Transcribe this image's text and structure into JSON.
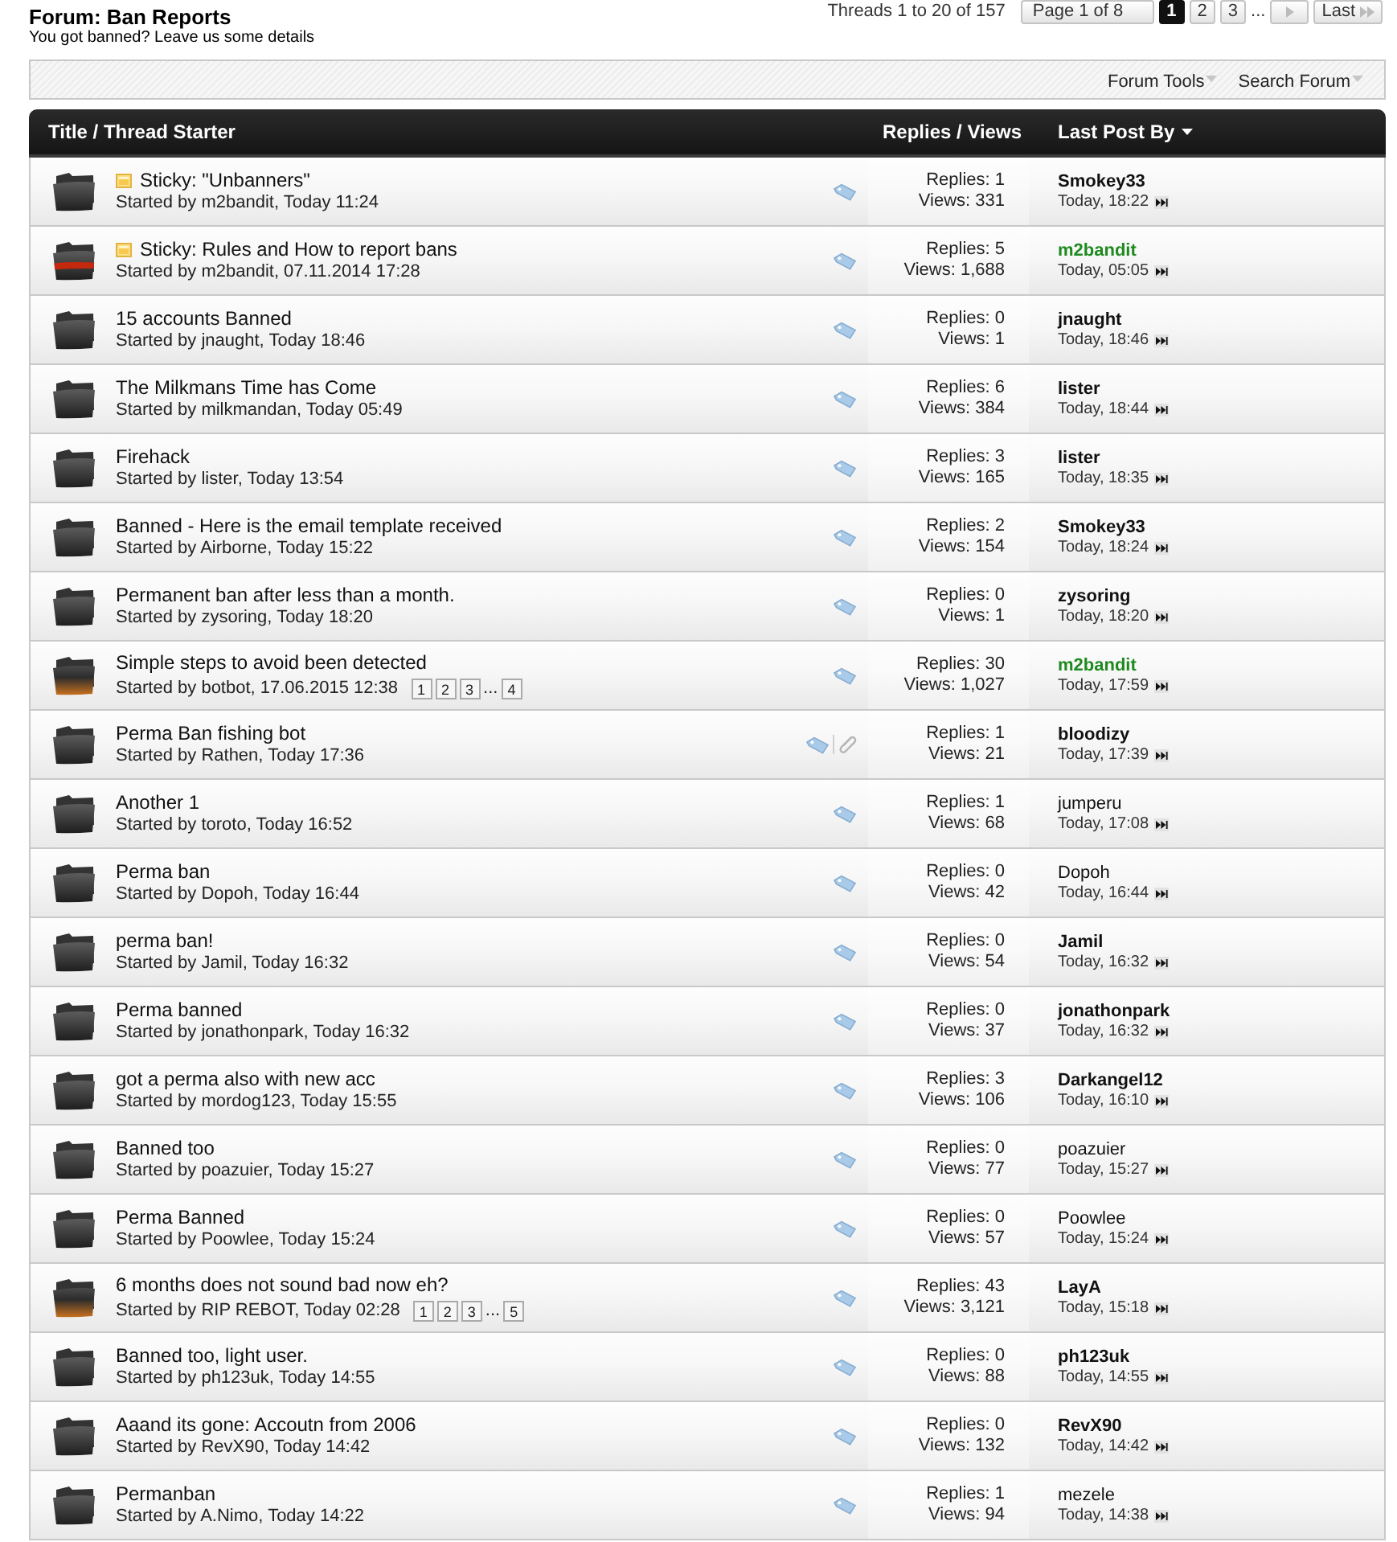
{
  "forum": {
    "title": "Forum: Ban Reports",
    "description": "You got banned? Leave us some details"
  },
  "pagination": {
    "summary": "Threads 1 to 20 of 157",
    "page_label": "Page 1 of 8",
    "pages": [
      {
        "label": "1",
        "selected": true
      },
      {
        "label": "2",
        "selected": false
      },
      {
        "label": "3",
        "selected": false
      }
    ],
    "gap": "...",
    "last": "Last"
  },
  "toolbar": [
    {
      "label": "Forum Tools"
    },
    {
      "label": "Search Forum"
    }
  ],
  "columns": [
    {
      "label": "Title / Thread Starter",
      "sorted": false
    },
    {
      "label": "Replies / Views",
      "sorted": false
    },
    {
      "label": "Last Post By",
      "sorted": true
    }
  ],
  "threads": [
    {
      "hot": false,
      "banded": false,
      "sticky": true,
      "title": "Sticky: \"Unbanners\"",
      "starter": "Started by m2bandit, Today 11:24",
      "tagged": true,
      "attachment": false,
      "replies": "Replies: 1",
      "views": "Views: 331",
      "last_post": {
        "user": "Smokey33",
        "bold": true,
        "color": "#111111",
        "time": "Today, 18:22"
      }
    },
    {
      "hot": false,
      "banded": true,
      "sticky": true,
      "title": "Sticky: Rules and How to report bans",
      "starter": "Started by m2bandit, 07.11.2014 17:28",
      "tagged": true,
      "attachment": false,
      "replies": "Replies: 5",
      "views": "Views: 1,688",
      "last_post": {
        "user": "m2bandit",
        "bold": true,
        "color": "#1f8a1f",
        "time": "Today, 05:05"
      }
    },
    {
      "hot": false,
      "banded": false,
      "sticky": false,
      "title": "15 accounts Banned",
      "starter": "Started by jnaught, Today 18:46",
      "tagged": true,
      "attachment": false,
      "replies": "Replies: 0",
      "views": "Views: 1",
      "last_post": {
        "user": "jnaught",
        "bold": true,
        "color": "#111111",
        "time": "Today, 18:46"
      }
    },
    {
      "hot": false,
      "banded": false,
      "sticky": false,
      "title": "The Milkmans Time has Come",
      "starter": "Started by milkmandan, Today 05:49",
      "tagged": true,
      "attachment": false,
      "replies": "Replies: 6",
      "views": "Views: 384",
      "last_post": {
        "user": "lister",
        "bold": true,
        "color": "#111111",
        "time": "Today, 18:44"
      }
    },
    {
      "hot": false,
      "banded": false,
      "sticky": false,
      "title": "Firehack",
      "starter": "Started by lister, Today 13:54",
      "tagged": true,
      "attachment": false,
      "replies": "Replies: 3",
      "views": "Views: 165",
      "last_post": {
        "user": "lister",
        "bold": true,
        "color": "#111111",
        "time": "Today, 18:35"
      }
    },
    {
      "hot": false,
      "banded": false,
      "sticky": false,
      "title": "Banned - Here is the email template received",
      "starter": "Started by Airborne, Today 15:22",
      "tagged": true,
      "attachment": false,
      "replies": "Replies: 2",
      "views": "Views: 154",
      "last_post": {
        "user": "Smokey33",
        "bold": true,
        "color": "#111111",
        "time": "Today, 18:24"
      }
    },
    {
      "hot": false,
      "banded": false,
      "sticky": false,
      "title": "Permanent ban after less than a month.",
      "starter": "Started by zysoring, Today 18:20",
      "tagged": true,
      "attachment": false,
      "replies": "Replies: 0",
      "views": "Views: 1",
      "last_post": {
        "user": "zysoring",
        "bold": true,
        "color": "#111111",
        "time": "Today, 18:20"
      }
    },
    {
      "hot": true,
      "banded": false,
      "sticky": false,
      "title": "Simple steps to avoid been detected",
      "starter": "Started by botbot, 17.06.2015 12:38",
      "pages": [
        "1",
        "2",
        "3"
      ],
      "gap": "...",
      "last_page": "4",
      "tagged": true,
      "attachment": false,
      "replies": "Replies: 30",
      "views": "Views: 1,027",
      "last_post": {
        "user": "m2bandit",
        "bold": true,
        "color": "#1f8a1f",
        "time": "Today, 17:59"
      }
    },
    {
      "hot": false,
      "banded": false,
      "sticky": false,
      "title": "Perma Ban fishing bot",
      "starter": "Started by Rathen, Today 17:36",
      "tagged": true,
      "attachment": true,
      "replies": "Replies: 1",
      "views": "Views: 21",
      "last_post": {
        "user": "bloodizy",
        "bold": true,
        "color": "#111111",
        "time": "Today, 17:39"
      }
    },
    {
      "hot": false,
      "banded": false,
      "sticky": false,
      "title": "Another 1",
      "starter": "Started by toroto, Today 16:52",
      "tagged": true,
      "attachment": false,
      "replies": "Replies: 1",
      "views": "Views: 68",
      "last_post": {
        "user": "jumperu",
        "bold": false,
        "color": "#111111",
        "time": "Today, 17:08"
      }
    },
    {
      "hot": false,
      "banded": false,
      "sticky": false,
      "title": "Perma ban",
      "starter": "Started by Dopoh, Today 16:44",
      "tagged": true,
      "attachment": false,
      "replies": "Replies: 0",
      "views": "Views: 42",
      "last_post": {
        "user": "Dopoh",
        "bold": false,
        "color": "#111111",
        "time": "Today, 16:44"
      }
    },
    {
      "hot": false,
      "banded": false,
      "sticky": false,
      "title": "perma ban!",
      "starter": "Started by Jamil, Today 16:32",
      "tagged": true,
      "attachment": false,
      "replies": "Replies: 0",
      "views": "Views: 54",
      "last_post": {
        "user": "Jamil",
        "bold": true,
        "color": "#111111",
        "time": "Today, 16:32"
      }
    },
    {
      "hot": false,
      "banded": false,
      "sticky": false,
      "title": "Perma banned",
      "starter": "Started by jonathonpark, Today 16:32",
      "tagged": true,
      "attachment": false,
      "replies": "Replies: 0",
      "views": "Views: 37",
      "last_post": {
        "user": "jonathonpark",
        "bold": true,
        "color": "#111111",
        "time": "Today, 16:32"
      }
    },
    {
      "hot": false,
      "banded": false,
      "sticky": false,
      "title": "got a perma also with new acc",
      "starter": "Started by mordog123, Today 15:55",
      "tagged": true,
      "attachment": false,
      "replies": "Replies: 3",
      "views": "Views: 106",
      "last_post": {
        "user": "Darkangel12",
        "bold": true,
        "color": "#111111",
        "time": "Today, 16:10"
      }
    },
    {
      "hot": false,
      "banded": false,
      "sticky": false,
      "title": "Banned too",
      "starter": "Started by poazuier, Today 15:27",
      "tagged": true,
      "attachment": false,
      "replies": "Replies: 0",
      "views": "Views: 77",
      "last_post": {
        "user": "poazuier",
        "bold": false,
        "color": "#111111",
        "time": "Today, 15:27"
      }
    },
    {
      "hot": false,
      "banded": false,
      "sticky": false,
      "title": "Perma Banned",
      "starter": "Started by Poowlee, Today 15:24",
      "tagged": true,
      "attachment": false,
      "replies": "Replies: 0",
      "views": "Views: 57",
      "last_post": {
        "user": "Poowlee",
        "bold": false,
        "color": "#111111",
        "time": "Today, 15:24"
      }
    },
    {
      "hot": true,
      "banded": false,
      "sticky": false,
      "title": "6 months does not sound bad now eh?",
      "starter": "Started by RIP REBOT, Today 02:28",
      "pages": [
        "1",
        "2",
        "3"
      ],
      "gap": "...",
      "last_page": "5",
      "tagged": true,
      "attachment": false,
      "replies": "Replies: 43",
      "views": "Views: 3,121",
      "last_post": {
        "user": "LayA",
        "bold": true,
        "color": "#111111",
        "time": "Today, 15:18"
      }
    },
    {
      "hot": false,
      "banded": false,
      "sticky": false,
      "title": "Banned too, light user.",
      "starter": "Started by ph123uk, Today 14:55",
      "tagged": true,
      "attachment": false,
      "replies": "Replies: 0",
      "views": "Views: 88",
      "last_post": {
        "user": "ph123uk",
        "bold": true,
        "color": "#111111",
        "time": "Today, 14:55"
      }
    },
    {
      "hot": false,
      "banded": false,
      "sticky": false,
      "title": "Aaand its gone: Accoutn from 2006",
      "starter": "Started by RevX90, Today 14:42",
      "tagged": true,
      "attachment": false,
      "replies": "Replies: 0",
      "views": "Views: 132",
      "last_post": {
        "user": "RevX90",
        "bold": true,
        "color": "#111111",
        "time": "Today, 14:42"
      }
    },
    {
      "hot": false,
      "banded": false,
      "sticky": false,
      "title": "Permanban",
      "starter": "Started by A.Nimo, Today 14:22",
      "tagged": true,
      "attachment": false,
      "replies": "Replies: 1",
      "views": "Views: 94",
      "last_post": {
        "user": "mezele",
        "bold": false,
        "color": "#111111",
        "time": "Today, 14:38"
      }
    }
  ]
}
